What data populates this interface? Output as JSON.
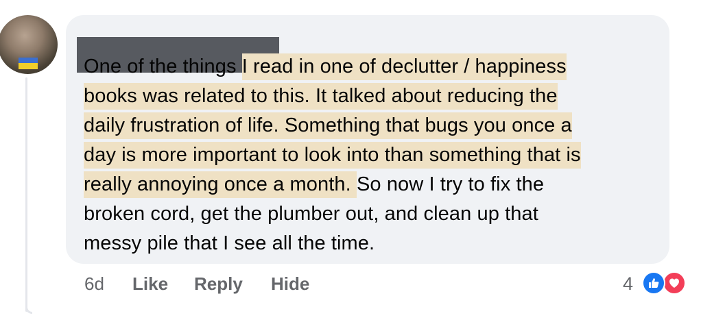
{
  "comment": {
    "lines": [
      {
        "plain": "One of the things ",
        "highlight": "I read in one of declutter / happiness"
      },
      {
        "plain": "",
        "highlight": "books was related to this.  It talked about reducing the"
      },
      {
        "plain": "",
        "highlight": "daily frustration of life.  Something that bugs you once a"
      },
      {
        "plain": "",
        "highlight": "day is more important to look into than something that is"
      },
      {
        "highlight": "really annoying once a month. ",
        "plain_after": " So now I try to fix the"
      },
      {
        "plain": "broken cord, get the plumber out, and clean up that"
      },
      {
        "plain": "messy pile that I see all the time."
      }
    ],
    "highlight_color": "#efe1c4"
  },
  "actions": {
    "timestamp": "6d",
    "like_label": "Like",
    "reply_label": "Reply",
    "hide_label": "Hide"
  },
  "reactions": {
    "count": "4",
    "types": [
      "like-icon",
      "love-icon"
    ],
    "like_color": "#1877f2",
    "love_color": "#f33e58"
  },
  "colors": {
    "bubble": "#f0f2f5",
    "meta_text": "#65676b",
    "body_text": "#050505"
  }
}
